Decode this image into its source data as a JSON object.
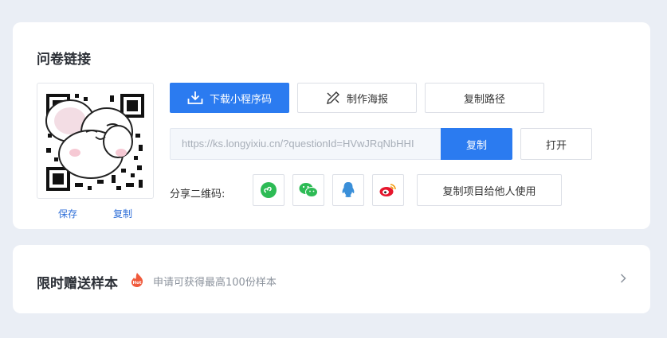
{
  "link_section": {
    "title": "问卷链接",
    "qr_actions": {
      "save": "保存",
      "copy": "复制"
    },
    "buttons": {
      "download_miniprogram": "下载小程序码",
      "make_poster": "制作海报",
      "copy_path": "复制路径"
    },
    "url": "https://ks.longyixiu.cn/?questionId=HVwJRqNbHHI",
    "copy_label": "复制",
    "open_label": "打开",
    "share_label": "分享二维码:",
    "share_icons": [
      "miniprogram-icon",
      "wechat-icon",
      "qq-icon",
      "weibo-icon"
    ],
    "share_project_label": "复制项目给他人使用"
  },
  "promo": {
    "title": "限时赠送样本",
    "badge": "Hot",
    "subtitle": "申请可获得最高100份样本"
  },
  "colors": {
    "primary": "#2b7bf0",
    "background": "#eaeef5",
    "link": "#2f6fd8",
    "hot": "#f05a3c"
  }
}
